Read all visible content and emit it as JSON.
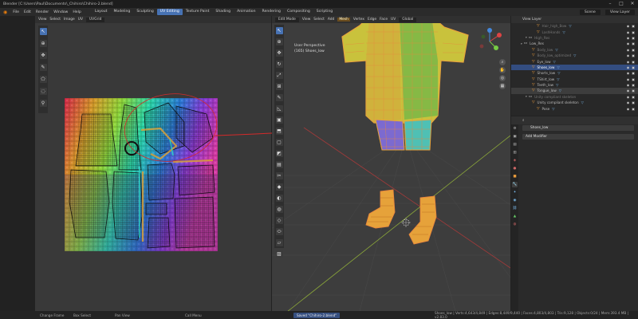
{
  "window": {
    "title": "Blender [C:\\Users\\Paul\\Documents\\_Chihiro\\Chihiro-2.blend]",
    "controls": [
      "–",
      "□",
      "✕"
    ]
  },
  "menubar": {
    "menus": [
      "File",
      "Edit",
      "Render",
      "Window",
      "Help"
    ],
    "workspaces": [
      "Layout",
      "Modeling",
      "Sculpting",
      "UV Editing",
      "Texture Paint",
      "Shading",
      "Animation",
      "Rendering",
      "Compositing",
      "Scripting"
    ],
    "active_workspace": "UV Editing",
    "scene": "Scene",
    "view_layer": "View Layer"
  },
  "uv_editor": {
    "header": [
      "View",
      "Select",
      "Image",
      "UV"
    ],
    "image_name": "UVGrid"
  },
  "viewport": {
    "mode": "Edit Mode",
    "header": [
      "View",
      "Select",
      "Add",
      "Mesh",
      "Vertex",
      "Edge",
      "Face",
      "UV"
    ],
    "highlighted": "Mesh",
    "orientation": "Global",
    "info_line1": "User Perspective",
    "info_line2": "(165) Shoes_low"
  },
  "outliner": {
    "rows": [
      {
        "label": "Hair_high_Bow",
        "indent": 4,
        "kind": "ob",
        "dim": true
      },
      {
        "label": "LashHands",
        "indent": 4,
        "kind": "ob",
        "dim": true
      },
      {
        "label": "High_Res",
        "indent": 2,
        "kind": "gr",
        "dim": true
      },
      {
        "label": "Low_Res",
        "indent": 1,
        "kind": "gr",
        "dim": false
      },
      {
        "label": "Body_low",
        "indent": 3,
        "kind": "ob",
        "dim": true
      },
      {
        "label": "Body_low_optimized",
        "indent": 3,
        "kind": "ob",
        "dim": true
      },
      {
        "label": "Eye_low",
        "indent": 3,
        "kind": "ob",
        "dim": false
      },
      {
        "label": "Shoes_low",
        "indent": 3,
        "kind": "ob",
        "dim": false,
        "selected": true
      },
      {
        "label": "Shorts_low",
        "indent": 3,
        "kind": "ob",
        "dim": false
      },
      {
        "label": "TShirt_low",
        "indent": 3,
        "kind": "ob",
        "dim": false
      },
      {
        "label": "Teeth_low",
        "indent": 3,
        "kind": "ob",
        "dim": false
      },
      {
        "label": "Tongue_low",
        "indent": 3,
        "kind": "ob",
        "dim": false,
        "active": true
      },
      {
        "label": "Unity compliant skeleton",
        "indent": 2,
        "kind": "gr",
        "dim": true
      },
      {
        "label": "Unity compliant skeleton",
        "indent": 3,
        "kind": "ob",
        "dim": false
      },
      {
        "label": "Pose",
        "indent": 4,
        "kind": "ob",
        "dim": false
      }
    ]
  },
  "properties": {
    "object_name": "Shoes_low",
    "add_modifier": "Add Modifier"
  },
  "statusbar": {
    "change_frame": "Change Frame",
    "box_select": "Box Select",
    "pan_view": "Pan View",
    "call_menu": "Call Menu",
    "saved": "Saved \"Chihiro-2.blend\"",
    "stats": "Shoes_low | Verts:4,643/4,849 | Edges:8,449/9,440 | Faces:4,803/4,803 | Tris:9,128 | Objects:0/24 | Mem:393.4 MB | v2.83.0"
  },
  "colors": {
    "accent": "#4772b3",
    "selection": "#e89b3c",
    "annotation": "#d42a2a"
  }
}
